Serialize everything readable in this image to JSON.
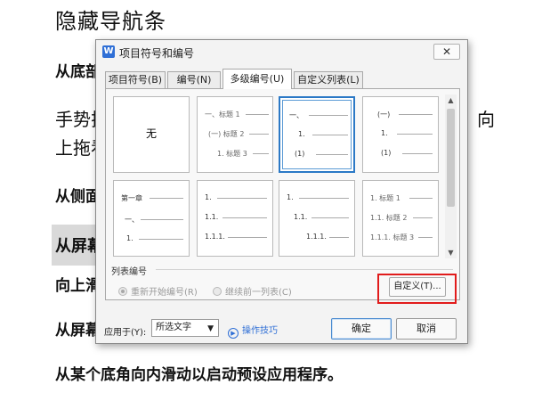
{
  "document": {
    "title": "隐藏导航条",
    "line1": "从底部",
    "line2": "手势拉",
    "line2_tail": "向",
    "line3": "上拖看",
    "line4": "从侧面",
    "line5": "从屏幕",
    "line6": "向上滑",
    "line7": "从屏幕",
    "line8": "从某个底角向内滑动以启动预设应用程序。"
  },
  "dialog": {
    "title": "项目符号和编号",
    "close_label": "✕",
    "tabs": [
      {
        "label": "项目符号(B)"
      },
      {
        "label": "编号(N)"
      },
      {
        "label": "多级编号(U)",
        "active": true
      },
      {
        "label": "自定义列表(L)"
      }
    ],
    "styles": {
      "none_label": "无",
      "style2": {
        "r1": "一、标题 1",
        "r2": "(一) 标题 2",
        "r3": "1. 标题 3"
      },
      "style3": {
        "r1": "一、",
        "r2": "1.",
        "r3": "(1)"
      },
      "style4": {
        "r1": "(一)",
        "r2": "1.",
        "r3": "(1)"
      },
      "style5": {
        "r1": "第一章",
        "r2": "一、",
        "r3": "1."
      },
      "style6": {
        "r1": "1.",
        "r2": "1.1.",
        "r3": "1.1.1."
      },
      "style7": {
        "r1": "1.",
        "r2": "1.1.",
        "r3": "1.1.1."
      },
      "style8": {
        "r1": "1. 标题 1",
        "r2": "1.1. 标题 2",
        "r3": "1.1.1. 标题 3"
      }
    },
    "list_numbering_label": "列表编号",
    "radio_restart": "重新开始编号(R)",
    "radio_continue": "继续前一列表(C)",
    "custom_button": "自定义(T)...",
    "apply_to_label": "应用于(Y):",
    "apply_to_value": "所选文字",
    "tips_label": "操作技巧",
    "ok_button": "确定",
    "cancel_button": "取消"
  },
  "colors": {
    "accent": "#2b79c6",
    "highlight_box": "#e11b1b"
  }
}
